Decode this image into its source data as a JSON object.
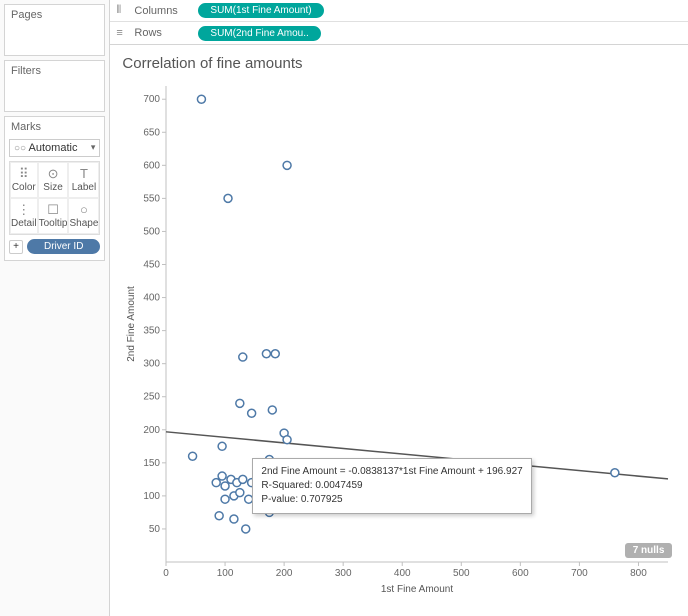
{
  "panels": {
    "pages": "Pages",
    "filters": "Filters",
    "marks": "Marks",
    "marks_dropdown": "Automatic",
    "mark_cells": [
      {
        "icon": "⠿",
        "label": "Color"
      },
      {
        "icon": "⊙",
        "label": "Size"
      },
      {
        "icon": "T",
        "label": "Label"
      },
      {
        "icon": "⋮",
        "label": "Detail"
      },
      {
        "icon": "☐",
        "label": "Tooltip"
      },
      {
        "icon": "○",
        "label": "Shape"
      }
    ],
    "detail_pill": "Driver ID",
    "plus_btn": "+"
  },
  "shelves": {
    "columns_label": "Columns",
    "rows_label": "Rows",
    "columns_pill": "SUM(1st Fine Amount)",
    "rows_pill": "SUM(2nd Fine Amou.."
  },
  "viz": {
    "title": "Correlation of fine amounts",
    "x_axis_label": "1st Fine Amount",
    "y_axis_label": "2nd Fine Amount",
    "nulls_badge": "7 nulls"
  },
  "tooltip": {
    "line1": "2nd Fine Amount = -0.0838137*1st Fine Amount + 196.927",
    "line2": "R-Squared: 0.0047459",
    "line3": "P-value: 0.707925"
  },
  "chart_data": {
    "type": "scatter",
    "title": "Correlation of fine amounts",
    "xlabel": "1st Fine Amount",
    "ylabel": "2nd Fine Amount",
    "xlim": [
      0,
      850
    ],
    "ylim": [
      0,
      720
    ],
    "x_ticks": [
      0,
      100,
      200,
      300,
      400,
      500,
      600,
      700,
      800
    ],
    "y_ticks": [
      50,
      100,
      150,
      200,
      250,
      300,
      350,
      400,
      450,
      500,
      550,
      600,
      650,
      700
    ],
    "points": [
      {
        "x": 60,
        "y": 700
      },
      {
        "x": 205,
        "y": 600
      },
      {
        "x": 105,
        "y": 550
      },
      {
        "x": 130,
        "y": 310
      },
      {
        "x": 170,
        "y": 315
      },
      {
        "x": 185,
        "y": 315
      },
      {
        "x": 125,
        "y": 240
      },
      {
        "x": 145,
        "y": 225
      },
      {
        "x": 180,
        "y": 230
      },
      {
        "x": 200,
        "y": 195
      },
      {
        "x": 205,
        "y": 185
      },
      {
        "x": 95,
        "y": 175
      },
      {
        "x": 45,
        "y": 160
      },
      {
        "x": 175,
        "y": 155
      },
      {
        "x": 760,
        "y": 135
      },
      {
        "x": 85,
        "y": 120
      },
      {
        "x": 95,
        "y": 130
      },
      {
        "x": 100,
        "y": 115
      },
      {
        "x": 110,
        "y": 125
      },
      {
        "x": 120,
        "y": 120
      },
      {
        "x": 130,
        "y": 125
      },
      {
        "x": 145,
        "y": 120
      },
      {
        "x": 100,
        "y": 95
      },
      {
        "x": 115,
        "y": 100
      },
      {
        "x": 125,
        "y": 105
      },
      {
        "x": 140,
        "y": 95
      },
      {
        "x": 155,
        "y": 95
      },
      {
        "x": 195,
        "y": 85
      },
      {
        "x": 175,
        "y": 75
      },
      {
        "x": 90,
        "y": 70
      },
      {
        "x": 115,
        "y": 65
      },
      {
        "x": 135,
        "y": 50
      }
    ],
    "trend": {
      "slope": -0.0838137,
      "intercept": 196.927
    }
  }
}
